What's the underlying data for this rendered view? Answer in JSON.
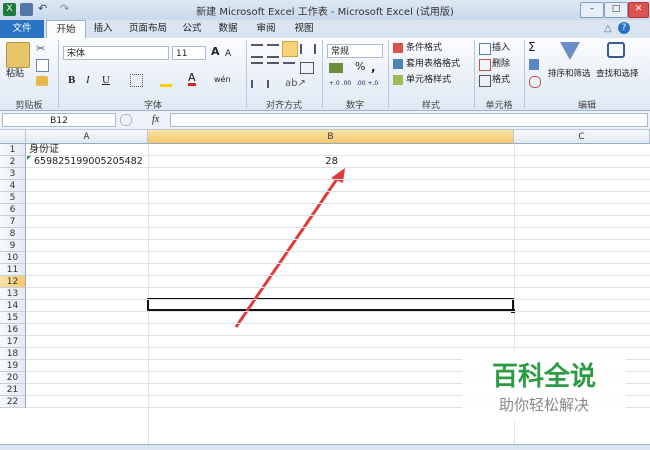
{
  "window": {
    "title": "新建 Microsoft Excel 工作表 - Microsoft Excel (试用版)"
  },
  "tabs": [
    "文件",
    "开始",
    "插入",
    "页面布局",
    "公式",
    "数据",
    "审阅",
    "视图"
  ],
  "clipboard": {
    "paste_label": "粘贴",
    "group_label": "剪贴板"
  },
  "font": {
    "name": "宋体",
    "size": "11",
    "group_label": "字体",
    "bold": "B",
    "italic": "I",
    "underline": "U",
    "grow": "A",
    "shrink": "A",
    "font_color": "A",
    "phonetic": "wén"
  },
  "alignment": {
    "group_label": "对齐方式"
  },
  "number": {
    "format": "常规",
    "percent": "%",
    "comma": ",",
    "group_label": "数字",
    "inc_decimal": "+.0 .00",
    "dec_decimal": ".00 +.0"
  },
  "styles": {
    "conditional": "条件格式",
    "table": "套用表格格式",
    "cell_styles": "单元格样式",
    "group_label": "样式"
  },
  "cells": {
    "insert": "插入",
    "delete": "删除",
    "format": "格式",
    "group_label": "单元格"
  },
  "editing": {
    "sigma": "Σ",
    "sort_filter": "排序和筛选",
    "find_select": "查找和选择",
    "group_label": "编辑"
  },
  "formula_bar": {
    "name_box": "B12",
    "fx": "fx",
    "content": ""
  },
  "columns": [
    "A",
    "B",
    "C"
  ],
  "rows": [
    "1",
    "2",
    "3",
    "4",
    "5",
    "6",
    "7",
    "8",
    "9",
    "10",
    "11",
    "12",
    "13",
    "14",
    "15",
    "16",
    "17",
    "18",
    "19",
    "20",
    "21",
    "22"
  ],
  "cells_data": {
    "A1": "身份证",
    "A2": "659825199005205482",
    "B2": "28"
  },
  "selected_cell": "B12",
  "watermark": {
    "title": "百科全说",
    "subtitle": "助你轻松解决"
  },
  "colors": {
    "accent": "#2a73c5",
    "arrow": "#e23b3b",
    "selected_header": "#f8d58a",
    "watermark": "#2e9b45"
  }
}
